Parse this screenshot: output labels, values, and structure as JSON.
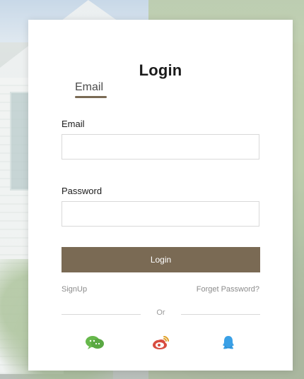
{
  "form": {
    "title": "Login",
    "tab_email": "Email",
    "email_label": "Email",
    "email_value": "",
    "password_label": "Password",
    "password_value": "",
    "login_button": "Login",
    "signup_link": "SignUp",
    "forgot_link": "Forget Password?",
    "or_text": "Or"
  },
  "social": {
    "icons": [
      "wechat-icon",
      "weibo-icon",
      "qq-icon"
    ],
    "colors": {
      "wechat": "#66b84b",
      "weibo": "#d84c3f",
      "qq": "#3aa0e6"
    }
  },
  "colors": {
    "accent": "#7a6a54",
    "card": "#ffffff",
    "input_border": "#d9d9d9",
    "muted_text": "#8b8b8b"
  }
}
